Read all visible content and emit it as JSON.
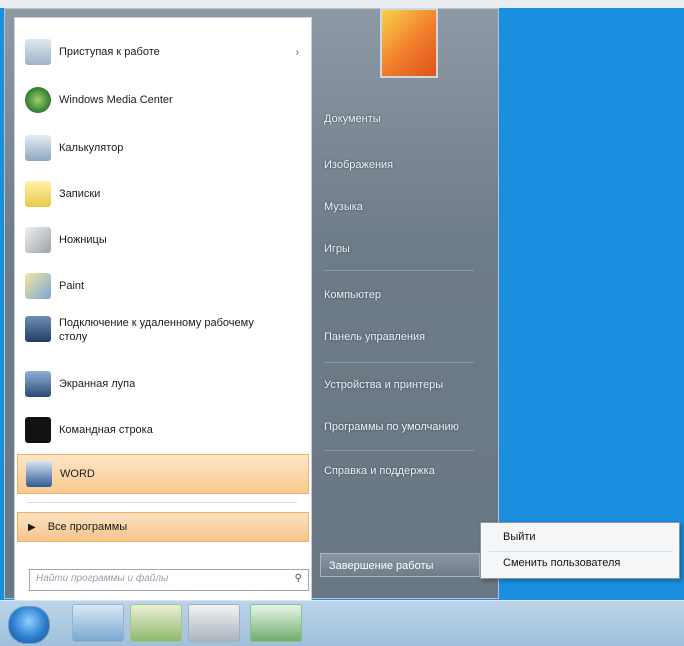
{
  "start_menu": {
    "programs": [
      {
        "label": "Приступая к работе",
        "icon": "getting-started-icon",
        "has_arrow": true
      },
      {
        "label": "Windows Media Center",
        "icon": "media-center-icon",
        "has_arrow": false
      },
      {
        "label": "Калькулятор",
        "icon": "calculator-icon",
        "has_arrow": false
      },
      {
        "label": "Записки",
        "icon": "sticky-notes-icon",
        "has_arrow": false
      },
      {
        "label": "Ножницы",
        "icon": "snipping-tool-icon",
        "has_arrow": false
      },
      {
        "label": "Paint",
        "icon": "paint-icon",
        "has_arrow": false
      },
      {
        "label": "Подключение к удаленному рабочему столу",
        "icon": "remote-desktop-icon",
        "has_arrow": false
      },
      {
        "label": "Экранная лупа",
        "icon": "magnifier-icon",
        "has_arrow": false
      },
      {
        "label": "Командная строка",
        "icon": "cmd-icon",
        "has_arrow": false
      },
      {
        "label": "WORD",
        "icon": "word-icon",
        "has_arrow": false
      }
    ],
    "all_programs": "Все программы",
    "search_placeholder": "Найти программы и файлы"
  },
  "right_pane": {
    "items": [
      "Документы",
      "Изображения",
      "Музыка",
      "Игры",
      "Компьютер",
      "Панель управления",
      "Устройства и принтеры",
      "Программы по умолчанию",
      "Справка и поддержка"
    ],
    "shutdown": "Завершение работы"
  },
  "popup": {
    "items": [
      "Выйти",
      "Сменить пользователя"
    ]
  }
}
